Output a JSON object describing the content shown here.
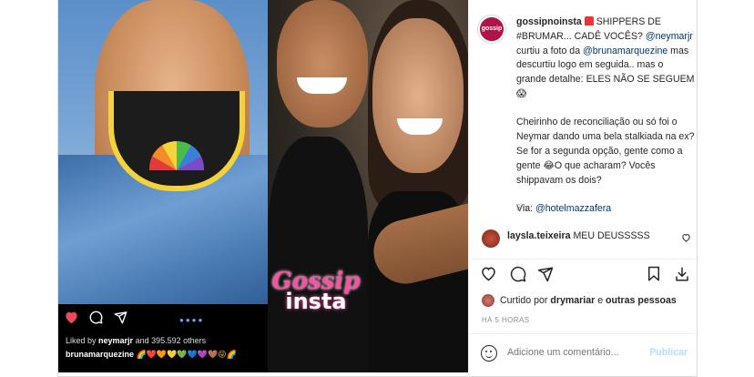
{
  "post": {
    "username": "gossipnoinsta",
    "avatar_label": "gossip",
    "caption": {
      "p1_part1": " SHIPPERS DE #BRUMAR... CADÊ VOCÊS? ",
      "mention1": "@neymarjr",
      "p1_part2": " curtiu a foto da ",
      "mention2": "@brunamarquezine",
      "p1_part3": " mas descurtiu logo em seguida.. mas o grande detalhe: ELES NÃO SE SEGUEM 😱",
      "p2": "Cheirinho de reconciliação ou só foi o Neymar dando uma bela stalkiada na ex? Se for a segunda opção, gente como a gente 😂O que acharam? Vocês shippavam os dois?",
      "via_label": "Via: ",
      "via_mention": "@hotelmazzafera"
    },
    "time_ago": "5 h"
  },
  "comments": [
    {
      "username": "laysla.teixeira",
      "text": " MEU DEUSSSSS"
    }
  ],
  "likes": {
    "prefix": "Curtido por ",
    "user": "drymariar",
    "middle": " e ",
    "others": "outras pessoas"
  },
  "timestamp": "HÁ 5 HORAS",
  "add_comment": {
    "placeholder": "Adicione um comentário...",
    "publish": "Publicar"
  },
  "embedded": {
    "liked_prefix": "Liked by ",
    "liked_user": "neymarjr",
    "liked_rest": " and 395.592 others",
    "caption_user": "brunamarquezine",
    "caption_emojis": " 🌈❤️🧡💛💚💙💜🤎😜🌈",
    "watermark_line1": "Gossip",
    "watermark_line2": "insta"
  },
  "colors": {
    "link": "#00376b",
    "publish_disabled": "#b2dffc",
    "muted": "#8e8e8e",
    "brand": "#b0124c",
    "like_red": "#ed4956"
  }
}
